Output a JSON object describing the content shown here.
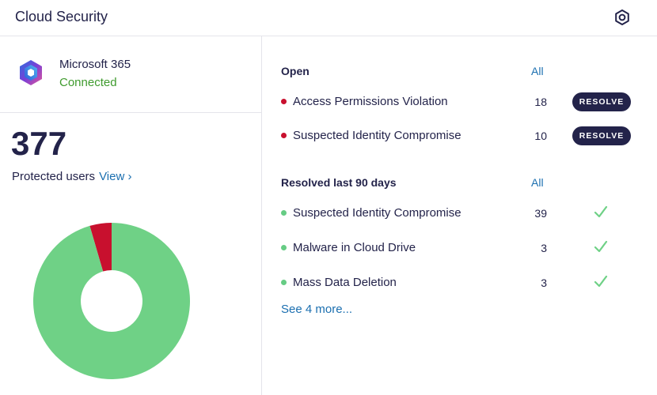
{
  "header": {
    "title": "Cloud Security",
    "settings_icon": "gear-icon"
  },
  "connection": {
    "name": "Microsoft 365",
    "status": "Connected",
    "status_color": "#3f9b2e",
    "logo_icon": "microsoft-365-logo"
  },
  "users": {
    "count": "377",
    "label": "Protected users",
    "view_link": "View ›"
  },
  "donut": {
    "segments": [
      {
        "key": "protected",
        "share": 0.955,
        "color": "#6fd186"
      },
      {
        "key": "issues",
        "share": 0.045,
        "color": "#c8102e"
      }
    ]
  },
  "open": {
    "title": "Open",
    "all_link": "All",
    "items": [
      {
        "label": "Access Permissions Violation",
        "count": "18",
        "action": "RESOLVE"
      },
      {
        "label": "Suspected Identity Compromise",
        "count": "10",
        "action": "RESOLVE"
      }
    ]
  },
  "resolved": {
    "title": "Resolved last 90 days",
    "all_link": "All",
    "items": [
      {
        "label": "Suspected Identity Compromise",
        "count": "39"
      },
      {
        "label": "Malware in Cloud Drive",
        "count": "3"
      },
      {
        "label": "Mass Data Deletion",
        "count": "3"
      }
    ],
    "see_more": "See 4 more..."
  }
}
